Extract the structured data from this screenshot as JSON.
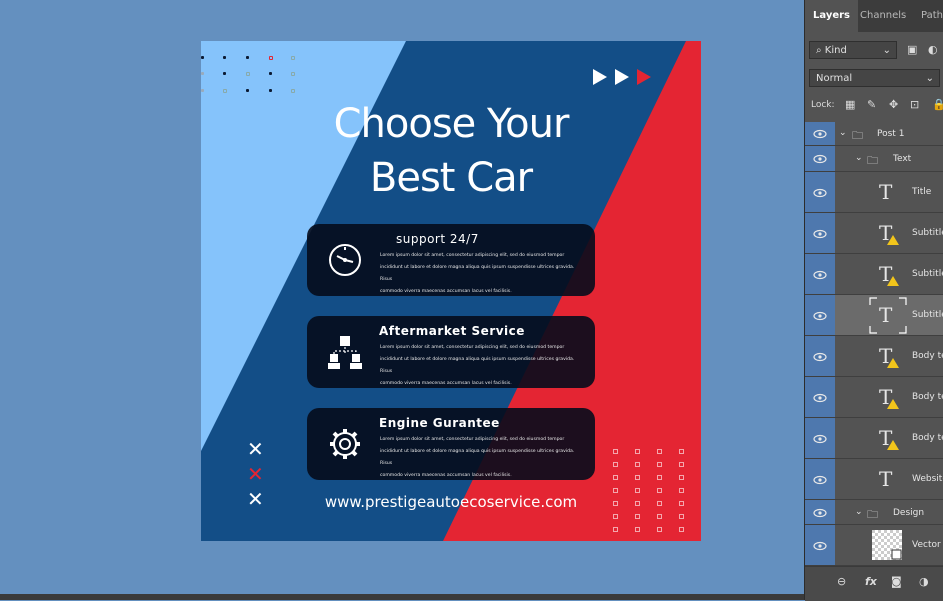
{
  "artboard": {
    "title_line1": "Choose Your",
    "title_line2": "Best Car",
    "cards": [
      {
        "title": "support 24/7",
        "body_lines": [
          "Lorem ipsum dolor sit amet, consectetur adipiscing elit, sed do eiusmod tempor",
          "incididunt ut labore et dolore magna aliqua quis ipsum suspendisse ultrices gravida. Risus",
          "commodo viverra maecenas accumsan lacus vel facilisis."
        ],
        "icon": "clock-icon"
      },
      {
        "title": "Aftermarket Service",
        "body_lines": [
          "Lorem ipsum dolor sit amet, consectetur adipiscing elit, sed do eiusmod tempor",
          "incididunt ut labore et dolore magna aliqua quis ipsum suspendisse ultrices gravida. Risus",
          "commodo viverra maecenas accumsan lacus vel facilisis."
        ],
        "icon": "team-network-icon"
      },
      {
        "title": "Engine Gurantee",
        "body_lines": [
          "Lorem ipsum dolor sit amet, consectetur adipiscing elit, sed do eiusmod tempor",
          "incididunt ut labore et dolore magna aliqua quis ipsum suspendisse ultrices gravida. Risus",
          "commodo viverra maecenas accumsan lacus vel facilisis."
        ],
        "icon": "gear-icon"
      }
    ],
    "website": "www.prestigeautoecoservice.com",
    "colors": {
      "light_blue": "#85c3fb",
      "dark_blue": "#134e87",
      "red": "#e42533",
      "card": "#050c1c"
    }
  },
  "panel": {
    "tabs": [
      "Layers",
      "Channels",
      "Paths"
    ],
    "filter": "Kind",
    "blend_mode": "Normal",
    "lock_label": "Lock:",
    "layers": [
      {
        "name": "Post 1",
        "type": "group"
      },
      {
        "name": "Text",
        "type": "group"
      },
      {
        "name": "Title",
        "type": "text"
      },
      {
        "name": "Subtitle",
        "type": "text-warning"
      },
      {
        "name": "Subtitle",
        "type": "text-warning"
      },
      {
        "name": "Subtitle",
        "type": "text-selected"
      },
      {
        "name": "Body te",
        "type": "text-warning"
      },
      {
        "name": "Body te",
        "type": "text-warning"
      },
      {
        "name": "Body te",
        "type": "text-warning"
      },
      {
        "name": "Website",
        "type": "text"
      },
      {
        "name": "Design",
        "type": "group"
      },
      {
        "name": "Vector",
        "type": "smart-object"
      }
    ],
    "footer_icons": [
      "link-icon",
      "fx-icon",
      "mask-icon",
      "adjustment-icon"
    ]
  }
}
